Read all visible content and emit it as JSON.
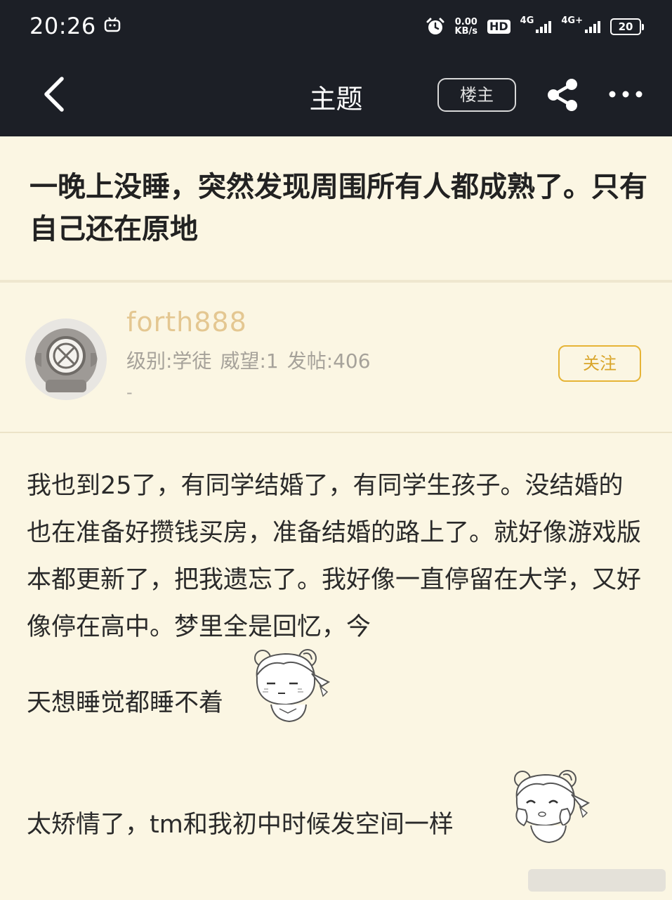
{
  "status_bar": {
    "time": "20:26",
    "net_speed_value": "0.00",
    "net_speed_unit": "KB/s",
    "hd_label": "HD",
    "sim1_label": "4G",
    "sim2_label": "4G+",
    "battery": "20"
  },
  "nav": {
    "title": "主题",
    "owner_button": "楼主"
  },
  "thread": {
    "title": "一晚上没睡，突然发现周围所有人都成熟了。只有自己还在原地"
  },
  "author": {
    "name": "forth888",
    "level": "级别:学徒",
    "prestige": "威望:1",
    "posts": "发帖:406",
    "signature": "-",
    "follow_button": "关注"
  },
  "post": {
    "paragraph1": "我也到25了，有同学结婚了，有同学生孩子。没结婚的也在准备好攒钱买房，准备结婚的路上了。就好像游戏版本都更新了，把我遗忘了。我好像一直停留在大学，又好像停在高中。梦里全是回忆，今",
    "paragraph1_end": "天想睡觉都睡不着",
    "paragraph2": "太矫情了，tm和我初中时候发空间一样"
  },
  "colors": {
    "nav_background": "#1c1f26",
    "page_background": "#fbf6e3",
    "author_name": "#e4c791",
    "follow_accent": "#e6b436"
  },
  "icons": {
    "back": "chevron-left-icon",
    "share": "share-icon",
    "more": "more-horizontal-icon",
    "alarm": "alarm-icon",
    "app": "bilibili-tv-icon"
  }
}
